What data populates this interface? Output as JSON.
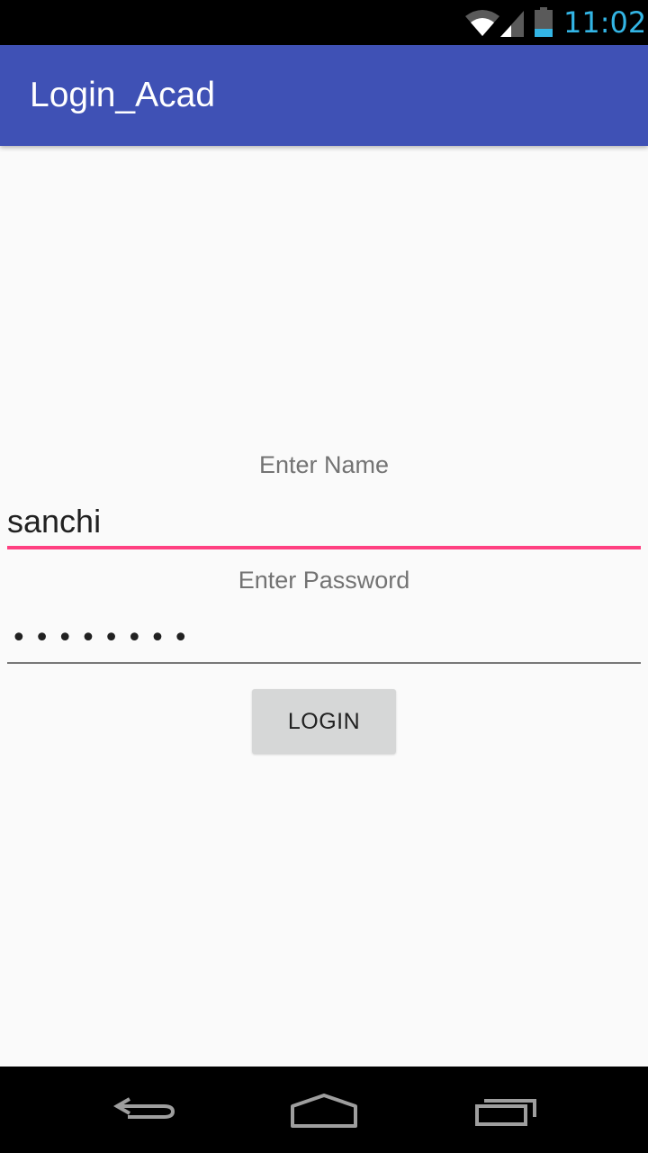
{
  "status_bar": {
    "time": "11:02",
    "icons": [
      "wifi-icon",
      "signal-icon",
      "battery-icon"
    ],
    "time_color": "#33b5e5"
  },
  "app_bar": {
    "title": "Login_Acad",
    "color": "#3f51b5"
  },
  "form": {
    "name_label": "Enter Name",
    "name_value": "sanchi",
    "password_label": "Enter Password",
    "password_value": "••••••••",
    "login_label": "LOGIN",
    "accent_color": "#ff4081"
  },
  "nav_bar": {
    "icons": [
      "back-icon",
      "home-icon",
      "recents-icon"
    ]
  }
}
